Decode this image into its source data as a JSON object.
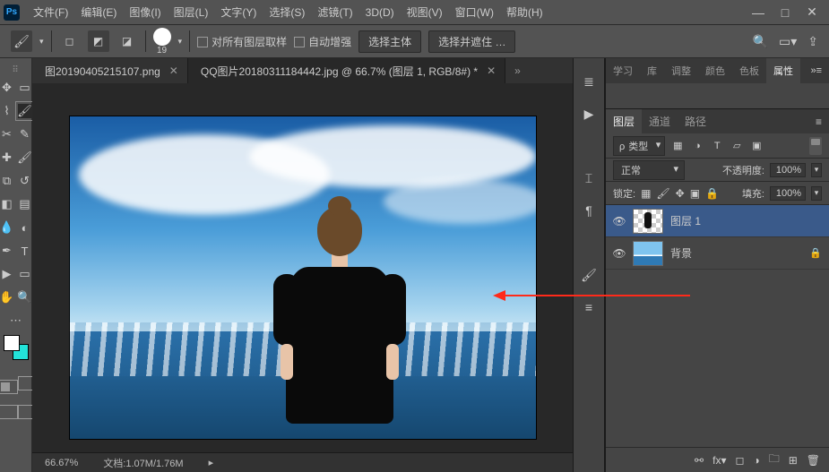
{
  "app": {
    "logo_text": "Ps"
  },
  "menu": {
    "file": "文件(F)",
    "edit": "编辑(E)",
    "image": "图像(I)",
    "layer": "图层(L)",
    "type": "文字(Y)",
    "select": "选择(S)",
    "filter": "滤镜(T)",
    "threeD": "3D(D)",
    "view": "视图(V)",
    "window": "窗口(W)",
    "help": "帮助(H)"
  },
  "options": {
    "brush_size": "19",
    "sample_all_layers_label": "对所有图层取样",
    "auto_enhance_label": "自动增强",
    "select_subject_label": "选择主体",
    "select_and_mask_label": "选择并遮住 …"
  },
  "tabs": {
    "tab1": "图20190405215107.png",
    "tab2": "QQ图片20180311184442.jpg @ 66.7% (图层 1, RGB/8#) *",
    "overflow": "»"
  },
  "status": {
    "zoom": "66.67%",
    "doc_label": "文档:",
    "doc_size": "1.07M/1.76M"
  },
  "panel_tabs": {
    "learn": "学习",
    "library": "库",
    "adjust": "调整",
    "color": "颜色",
    "swatch": "色板",
    "properties": "属性"
  },
  "layers_panel": {
    "tabs": {
      "layers": "图层",
      "channels": "通道",
      "paths": "路径"
    },
    "filter_kind": "类型",
    "blend_mode": "正常",
    "opacity_label": "不透明度:",
    "opacity_value": "100%",
    "lock_label": "锁定:",
    "fill_label": "填充:",
    "fill_value": "100%",
    "layer1_name": "图层 1",
    "bg_name": "背景"
  },
  "search_placeholder": "ρ 类型"
}
